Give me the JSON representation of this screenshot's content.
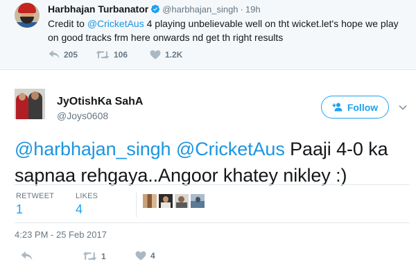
{
  "parent_tweet": {
    "author_name": "Harbhajan Turbanator",
    "author_handle": "@harbhajan_singh",
    "separator": "·",
    "time": "19h",
    "text_before": "Credit to ",
    "mention": "@CricketAus",
    "text_after": " 4 playing unbelievable well on tht wicket.let's hope we play on good tracks frm here onwards nd get th right results",
    "reply_count": "205",
    "retweet_count": "106",
    "like_count": "1.2K"
  },
  "tweet": {
    "author_name": "JyOtishKa SahA",
    "author_handle": "@Joys0608",
    "follow_label": "Follow",
    "mention_1": "@harbhajan_singh",
    "mention_2": "@CricketAus",
    "text": " Paaji 4-0 ka sapnaa rehgaya..Angoor khatey nikley :)",
    "retweets_label": "RETWEET",
    "retweets_value": "1",
    "likes_label": "LIKES",
    "likes_value": "4",
    "timestamp": "4:23 PM - 25 Feb 2017",
    "action_retweet_count": "1",
    "action_like_count": "4"
  },
  "colors": {
    "accent": "#1da1f2",
    "link": "#1b95e0",
    "muted": "#657786",
    "icon": "#aab8c2"
  },
  "icons": {
    "verified": "verified-badge-icon",
    "reply": "reply-icon",
    "retweet": "retweet-icon",
    "like": "heart-icon",
    "follow": "add-user-icon",
    "more": "chevron-down-icon"
  }
}
